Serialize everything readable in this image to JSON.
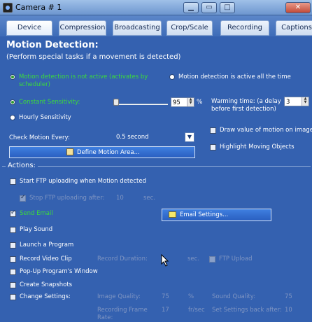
{
  "window": {
    "title": "Camera # 1",
    "controls": [
      "minimize",
      "restore",
      "maximize",
      "close"
    ]
  },
  "tabs": [
    {
      "label": "Device"
    },
    {
      "label": "Compression"
    },
    {
      "label": "Broadcasting"
    },
    {
      "label": "Crop/Scale"
    },
    {
      "label": "Recording"
    },
    {
      "label": "Captions"
    }
  ],
  "motion": {
    "title": "Motion Detection:",
    "subtitle": "(Perform special tasks if a movement is detected)",
    "mode_scheduler": "Motion detection is not active (activates by scheduler)",
    "mode_always": "Motion detection is active all the time",
    "sens_constant": "Constant Sensitivity:",
    "sens_hourly": "Hourly Sensitivity",
    "sensitivity_value": "95",
    "sensitivity_unit": "%",
    "sensitivity_level": 0.95,
    "warming_label": "Warming time: (a delay before first detection)",
    "warming_value": "3",
    "check_label": "Check Motion Every:",
    "check_value": "0.5 second",
    "draw_value": "Draw value of motion on image",
    "define_area": "Define Motion Area...",
    "highlight": "Highlight Moving Objects"
  },
  "actions": {
    "title": "Actions:",
    "ftp_upload": "Start FTP uploading when Motion detected",
    "stop_ftp": "Stop FTP uploading after:",
    "stop_ftp_value": "10",
    "stop_ftp_unit": "sec.",
    "send_email": "Send Email",
    "email_settings": "Email Settings...",
    "play_sound": "Play Sound",
    "launch_program": "Launch a Program",
    "record_video": "Record Video Clip",
    "record_duration": "Record Duration:",
    "record_unit": "sec.",
    "ftp_upload_small": "FTP Upload",
    "popup": "Pop-Up Program's Window",
    "snapshots": "Create Snapshots",
    "change_settings": "Change Settings:",
    "image_quality": "Image Quality:",
    "image_quality_value": "75",
    "image_quality_unit": "%",
    "sound_quality": "Sound Quality:",
    "sound_quality_value": "75",
    "frame_rate": "Recording Frame Rate:",
    "frame_rate_value": "17",
    "frame_rate_unit": "fr/sec",
    "set_back": "Set Settings back after:",
    "set_back_value": "10"
  }
}
